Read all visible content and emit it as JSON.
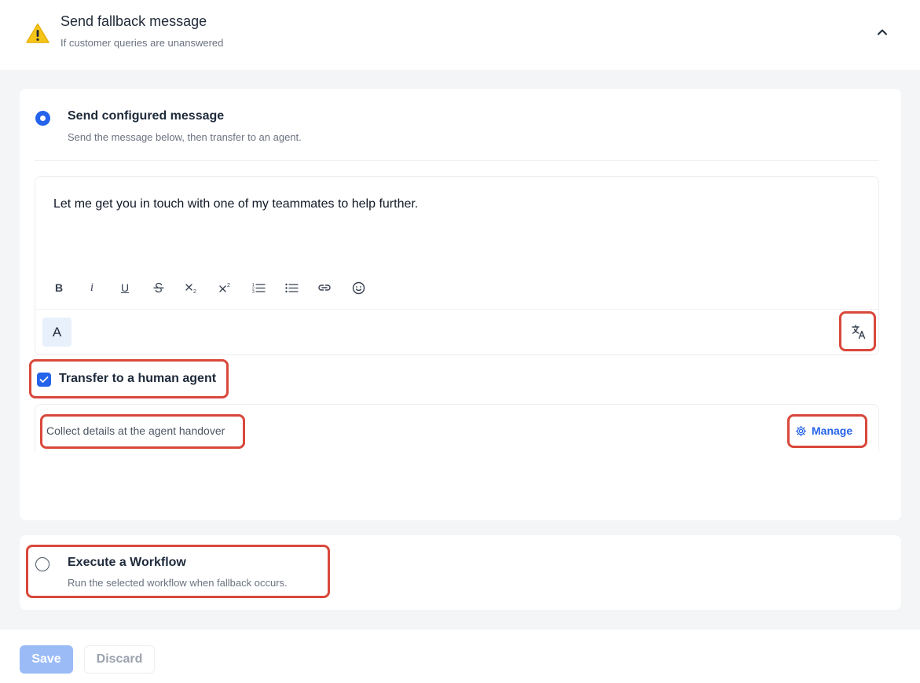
{
  "header": {
    "title": "Send fallback message",
    "subtitle": "If customer queries are unanswered",
    "icon": "warning-icon",
    "collapse_icon": "chevron-up-icon"
  },
  "option_configured": {
    "title": "Send configured message",
    "description": "Send the message below, then transfer to an agent.",
    "selected": true
  },
  "editor": {
    "message": "Let me get you in touch with one of my teammates to help further.",
    "toolbar": [
      "bold",
      "italic",
      "underline",
      "strikethrough",
      "subscript",
      "superscript",
      "ordered-list",
      "bullet-list",
      "link",
      "emoji"
    ],
    "bold_label": "B",
    "italic_label": "i",
    "underline_label": "U",
    "font_label": "A"
  },
  "transfer": {
    "label": "Transfer to a human agent",
    "checked": true,
    "handover_text": "Collect details at the agent handover",
    "manage_label": "Manage"
  },
  "option_workflow": {
    "title": "Execute a Workflow",
    "description": "Run the selected workflow when fallback occurs.",
    "selected": false
  },
  "footer": {
    "save_label": "Save",
    "discard_label": "Discard"
  },
  "colors": {
    "accent": "#2563eb",
    "highlight": "#d9483b",
    "warning": "#f5c518",
    "background": "#f4f5f7"
  }
}
